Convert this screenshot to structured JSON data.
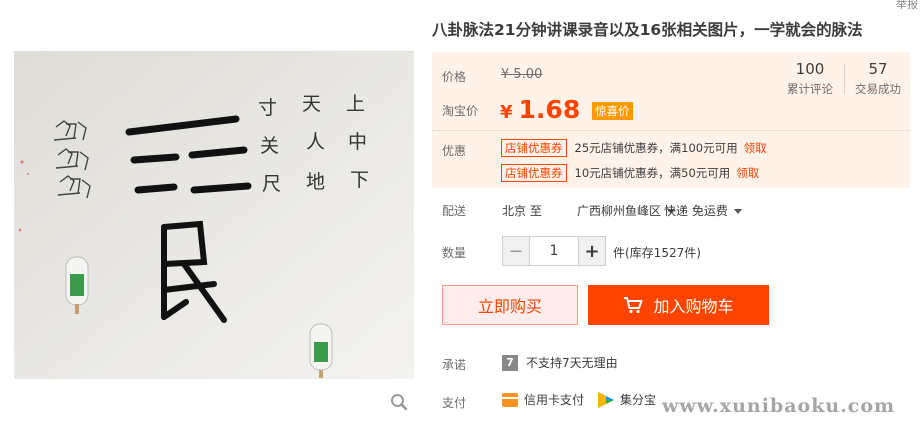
{
  "header": {
    "top_right_link": "举报"
  },
  "product": {
    "title": "八卦脉法21分钟讲课录音以及16张相关图片，一学就会的脉法",
    "price_label": "价格",
    "original_price": "¥ 5.00",
    "promo_label": "淘宝价",
    "currency": "¥",
    "current_price": "1.68",
    "price_badge": "惊喜价"
  },
  "stats": [
    {
      "num": "100",
      "label": "累计评论"
    },
    {
      "num": "57",
      "label": "交易成功"
    }
  ],
  "coupons": {
    "label": "优惠",
    "items": [
      {
        "tag": "店铺优惠券",
        "text": "25元店铺优惠券，满100元可用",
        "link": "领取"
      },
      {
        "tag": "店铺优惠券",
        "text": "10元店铺优惠券，满50元可用",
        "link": "领取"
      }
    ]
  },
  "delivery": {
    "label": "配送",
    "from": "北京 至",
    "to": "广西柳州鱼峰区",
    "method": "快递 免运费"
  },
  "quantity": {
    "label": "数量",
    "value": "1",
    "minus": "−",
    "plus": "+",
    "stock": "件(库存1527件)"
  },
  "actions": {
    "buy_now": "立即购买",
    "add_to_cart": "加入购物车"
  },
  "promise": {
    "label": "承诺",
    "icon_text": "7",
    "text": "不支持7天无理由"
  },
  "payment": {
    "label": "支付",
    "methods": [
      "信用卡支付",
      "集分宝"
    ]
  },
  "image": {
    "handwriting": [
      "寸",
      "天",
      "上",
      "关",
      "人",
      "中",
      "尺",
      "地",
      "下",
      "艮"
    ]
  },
  "watermark": "www.xunibaoku.com",
  "colors": {
    "accent": "#ff4400",
    "price": "#ff4400",
    "badge": "#ff9a00",
    "price_bg": "#fff2e8"
  },
  "icons": [
    "zoom-icon",
    "cart-icon",
    "caret-down-icon",
    "credit-card-icon",
    "jifenbao-icon"
  ]
}
